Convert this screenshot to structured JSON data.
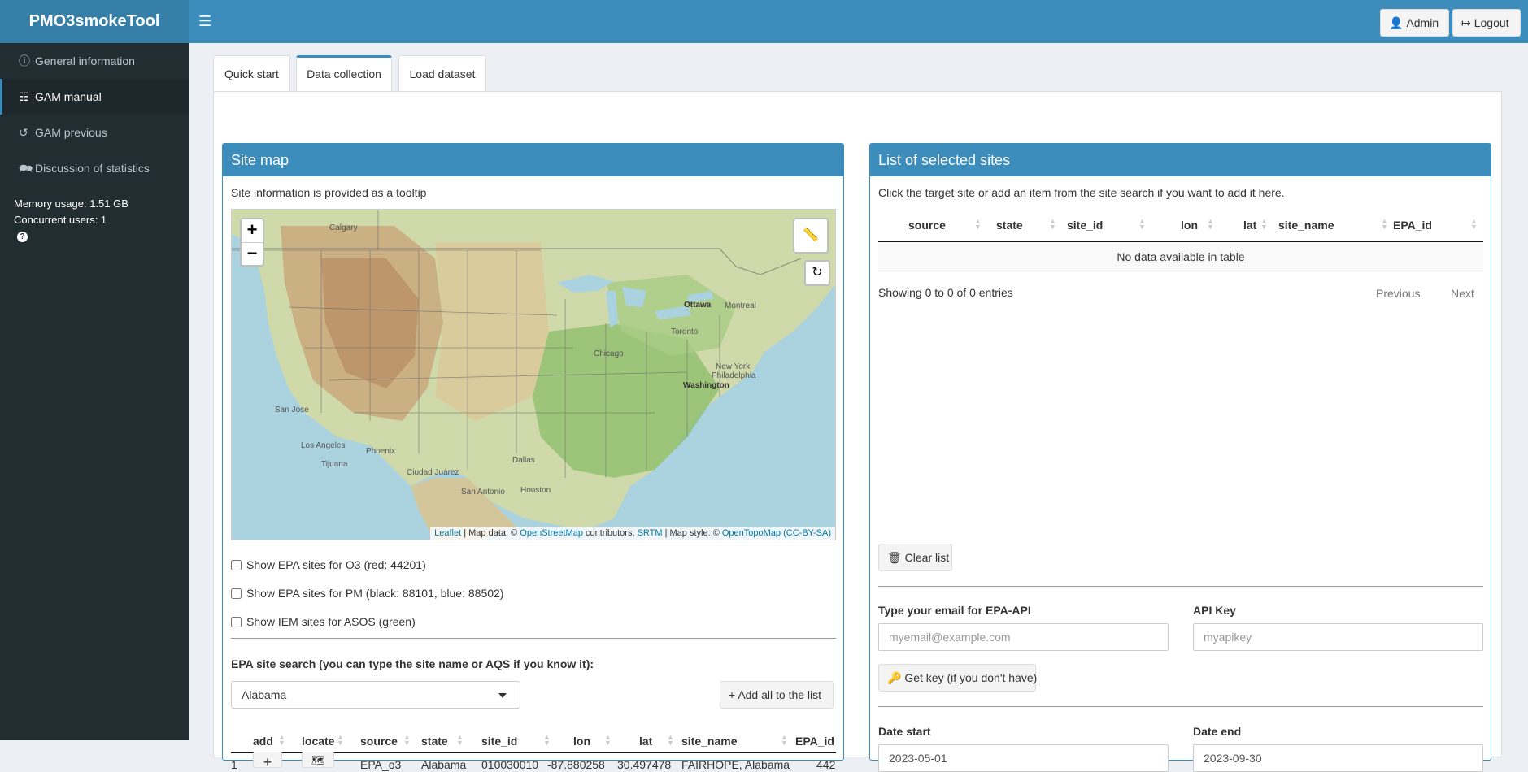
{
  "app": {
    "brand": "PMO3smokeTool"
  },
  "header": {
    "admin_label": "Admin",
    "logout_label": "Logout"
  },
  "sidebar": {
    "items": [
      {
        "label": "General information"
      },
      {
        "label": "GAM manual"
      },
      {
        "label": "GAM previous"
      },
      {
        "label": "Discussion of statistics"
      }
    ],
    "memory": "Memory usage: 1.51 GB",
    "users": "Concurrent users: 1"
  },
  "tabs": [
    {
      "label": "Quick start"
    },
    {
      "label": "Data collection"
    },
    {
      "label": "Load dataset"
    }
  ],
  "site_map": {
    "title": "Site map",
    "note": "Site information is provided as a tooltip",
    "attribution": {
      "leaflet": "Leaflet",
      "map_data": " | Map data: © ",
      "osm": "OpenStreetMap",
      "contributors": " contributors, ",
      "srtm": "SRTM",
      "style": " | Map style: © ",
      "otm": "OpenTopoMap",
      "license": "(CC-BY-SA)"
    },
    "cities": [
      "Calgary",
      "Ottawa",
      "Montreal",
      "Toronto",
      "Chicago",
      "New York",
      "Philadelphia",
      "Washington",
      "San Jose",
      "Los Angeles",
      "Tijuana",
      "Phoenix",
      "Ciudad Juárez",
      "Dallas",
      "San Antonio",
      "Houston"
    ],
    "checkboxes": [
      {
        "label": "Show EPA sites for O3 (red: 44201)"
      },
      {
        "label": "Show EPA sites for PM (black: 88101, blue: 88502)"
      },
      {
        "label": "Show IEM sites for ASOS (green)"
      }
    ],
    "search_label": "EPA site search (you can type the site name or AQS if you know it):",
    "select_value": "Alabama",
    "add_all_label": "Add all to the list",
    "table": {
      "headers": [
        "add",
        "locate",
        "source",
        "state",
        "site_id",
        "lon",
        "lat",
        "site_name",
        "EPA_id"
      ],
      "rows": [
        {
          "num": "1",
          "add": "+",
          "source": "EPA_o3",
          "state": "Alabama",
          "site_id": "010030010",
          "lon": "-87.880258",
          "lat": "30.497478",
          "site_name": "FAIRHOPE, Alabama",
          "epa_id": "442"
        }
      ]
    }
  },
  "selected": {
    "title": "List of selected sites",
    "note": "Click the target site or add an item from the site search if you want to add it here.",
    "headers": [
      "source",
      "state",
      "site_id",
      "lon",
      "lat",
      "site_name",
      "EPA_id"
    ],
    "empty": "No data available in table",
    "showing": "Showing 0 to 0 of 0 entries",
    "prev": "Previous",
    "next": "Next",
    "clear_label": "Clear list",
    "email_label": "Type your email for EPA-API",
    "email_placeholder": "myemail@example.com",
    "apikey_label": "API Key",
    "apikey_placeholder": "myapikey",
    "getkey_label": "Get key (if you don't have)",
    "date_start_label": "Date start",
    "date_start": "2023-05-01",
    "date_end_label": "Date end",
    "date_end": "2023-09-30"
  },
  "colors": {
    "primary": "#3c8dbc",
    "sidebar": "#222d32",
    "brand_bg": "#367fa9"
  }
}
